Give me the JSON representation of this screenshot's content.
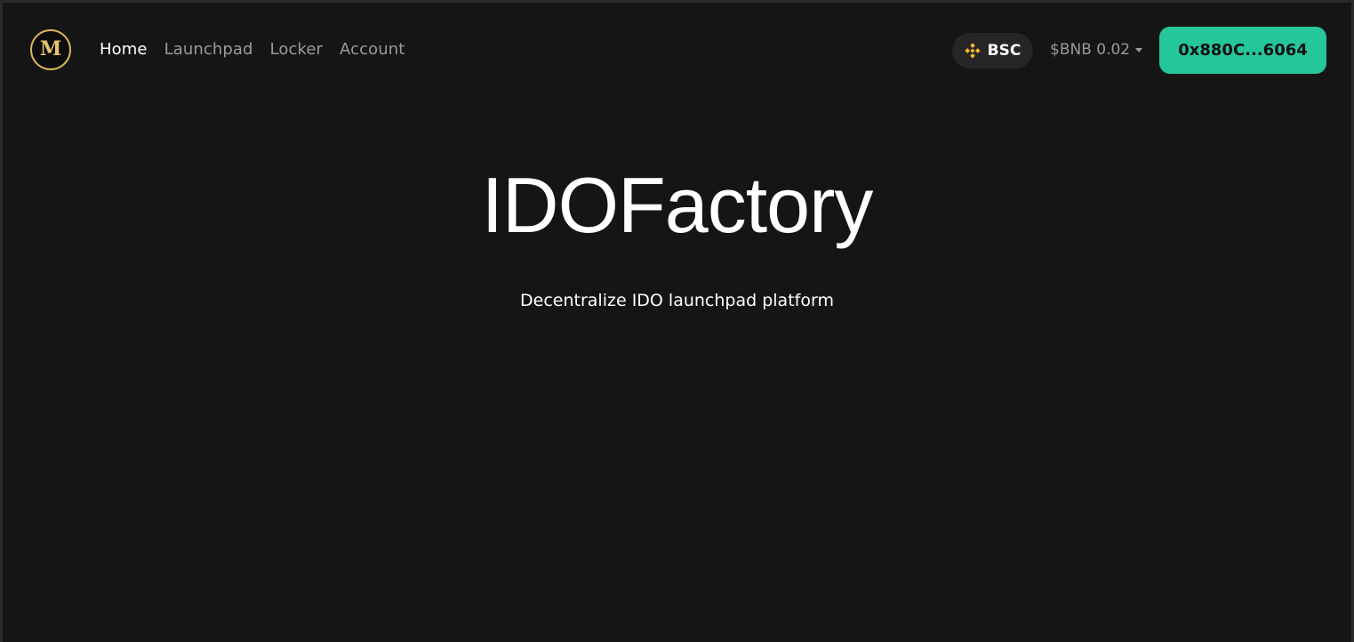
{
  "nav": {
    "logo_letter": "M",
    "links": [
      {
        "label": "Home",
        "active": true
      },
      {
        "label": "Launchpad",
        "active": false
      },
      {
        "label": "Locker",
        "active": false
      },
      {
        "label": "Account",
        "active": false
      }
    ],
    "network": {
      "label": "BSC",
      "icon": "bnb-icon"
    },
    "balance": "$BNB 0.02",
    "wallet_address": "0x880C...6064"
  },
  "hero": {
    "title": "IDOFactory",
    "subtitle": "Decentralize IDO launchpad platform"
  },
  "colors": {
    "background": "#151515",
    "accent": "#26c69b",
    "logo_gold": "#e6c46a",
    "bnb_yellow": "#f3ba2f",
    "muted_text": "#9a9a9a"
  }
}
